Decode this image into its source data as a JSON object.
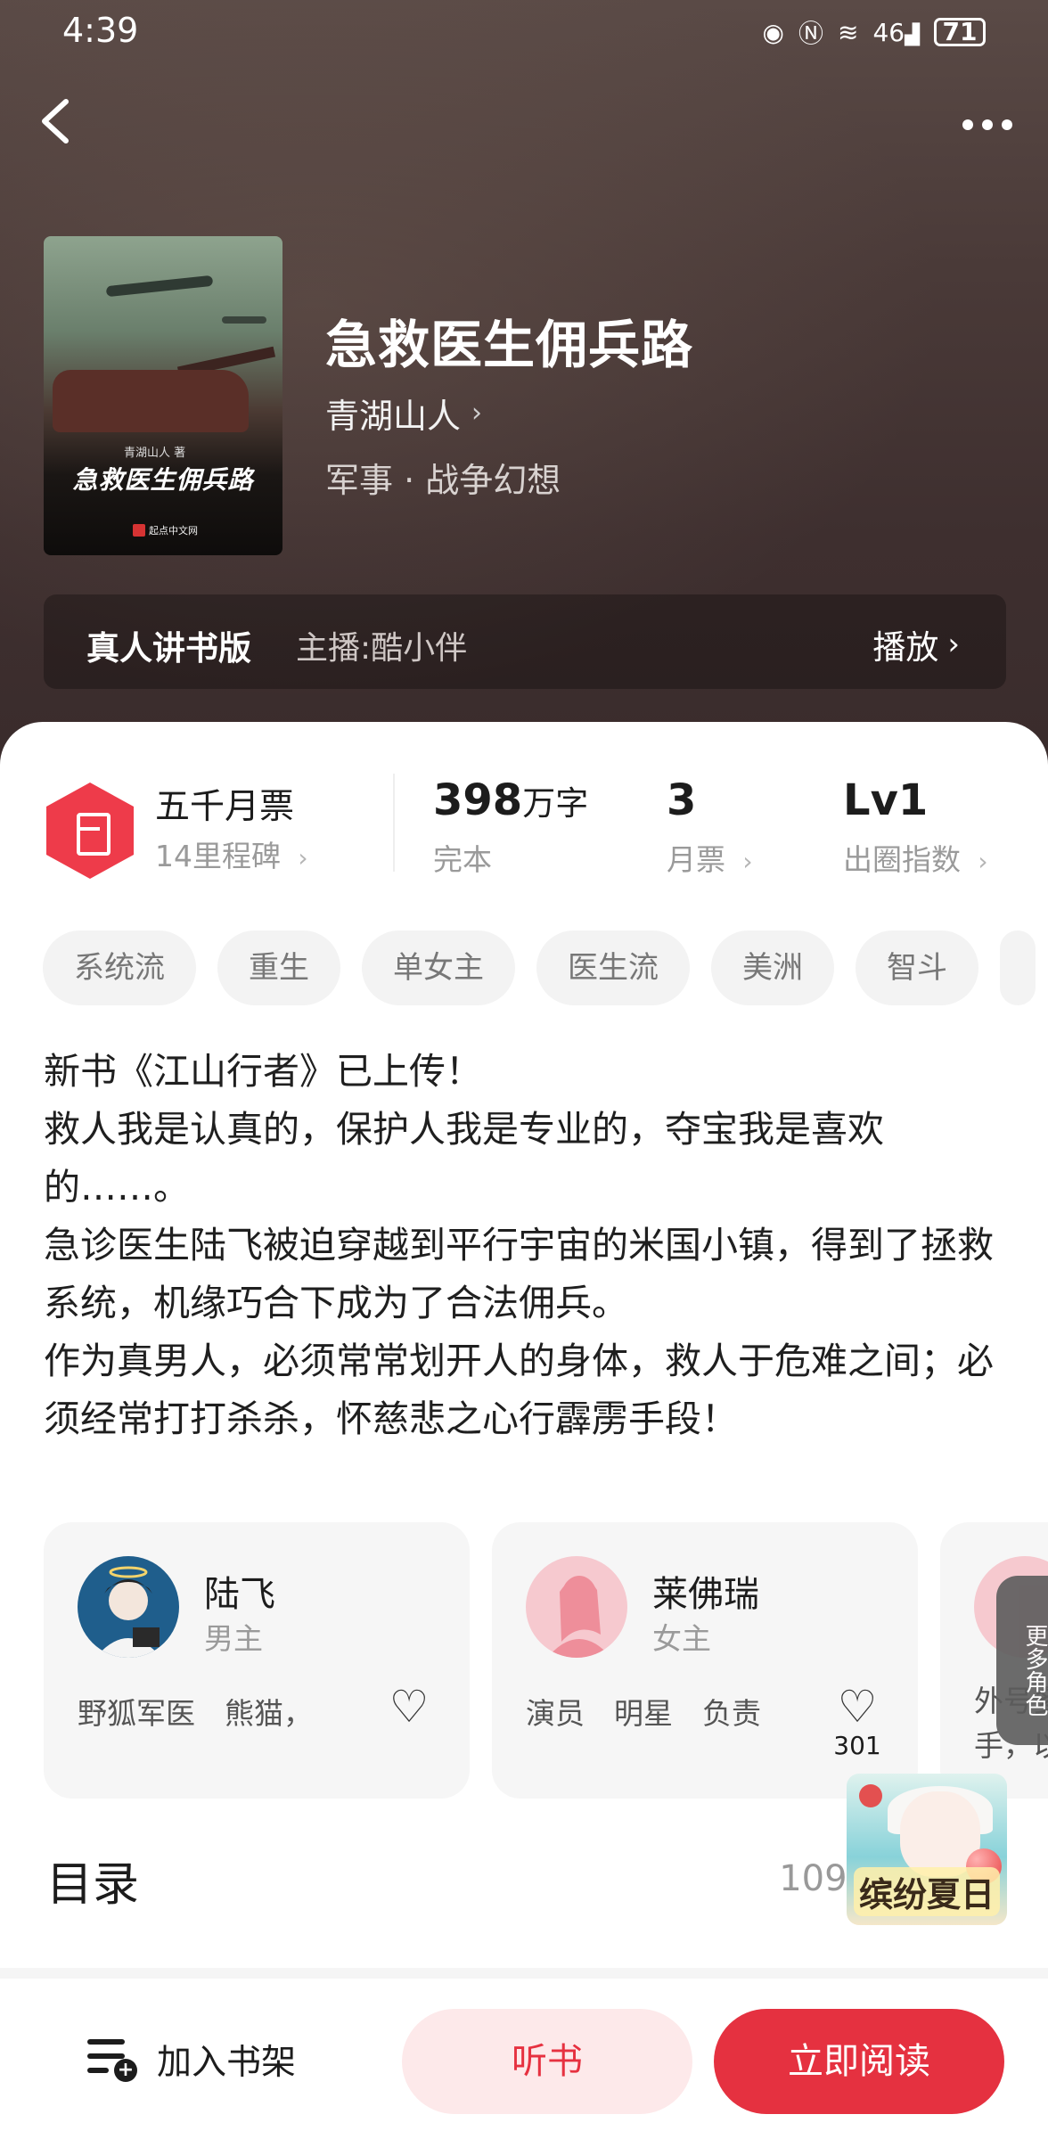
{
  "status_bar": {
    "time": "4:39",
    "battery": "71",
    "signal": "46"
  },
  "nav": {
    "back_icon": "chevron-left-icon",
    "more_icon": "more-horizontal-icon"
  },
  "book": {
    "cover_author": "青湖山人 著",
    "cover_title": "急救医生佣兵路",
    "cover_logo": "起点中文网",
    "title": "急救医生佣兵路",
    "author": "青湖山人",
    "genre": "军事 · 战争幻想"
  },
  "audio": {
    "title": "真人讲书版",
    "host": "主播:酷小伴",
    "play_label": "播放"
  },
  "stats": {
    "monthly_title": "五千月票",
    "monthly_sub": "14里程碑",
    "word_count": "398",
    "word_unit": "万字",
    "status": "完本",
    "monthly_tickets": "3",
    "monthly_tickets_label": "月票",
    "level": "Lv1",
    "level_label": "出圈指数"
  },
  "tags": [
    "系统流",
    "重生",
    "单女主",
    "医生流",
    "美洲",
    "智斗"
  ],
  "description": [
    "新书《江山行者》已上传！",
    "救人我是认真的，保护人我是专业的，夺宝我是喜欢的……。",
    "急诊医生陆飞被迫穿越到平行宇宙的米国小镇，得到了拯救系统，机缘巧合下成为了合法佣兵。",
    "作为真男人，必须常常划开人的身体，救人于危难之间；必须经常打打杀杀，怀慈悲之心行霹雳手段！"
  ],
  "characters": [
    {
      "name": "陆飞",
      "role": "男主",
      "traits": "野狐军医　熊猫，",
      "likes": ""
    },
    {
      "name": "莱佛瑞",
      "role": "女主",
      "traits": "演员　明星　负责",
      "likes": "301"
    },
    {
      "name": "",
      "role": "",
      "traits": "外号多",
      "traits2": "手，以",
      "likes": ""
    }
  ],
  "more_roles": "更多角色",
  "catalog": {
    "title": "目录",
    "count": "1097"
  },
  "promo": {
    "text": "缤纷夏日"
  },
  "bottom_bar": {
    "shelf_label": "加入书架",
    "listen_label": "听书",
    "read_label": "立即阅读"
  },
  "colors": {
    "accent": "#e53140",
    "accent_light": "#fde9ea",
    "hero_bg": "#4a3a38"
  }
}
